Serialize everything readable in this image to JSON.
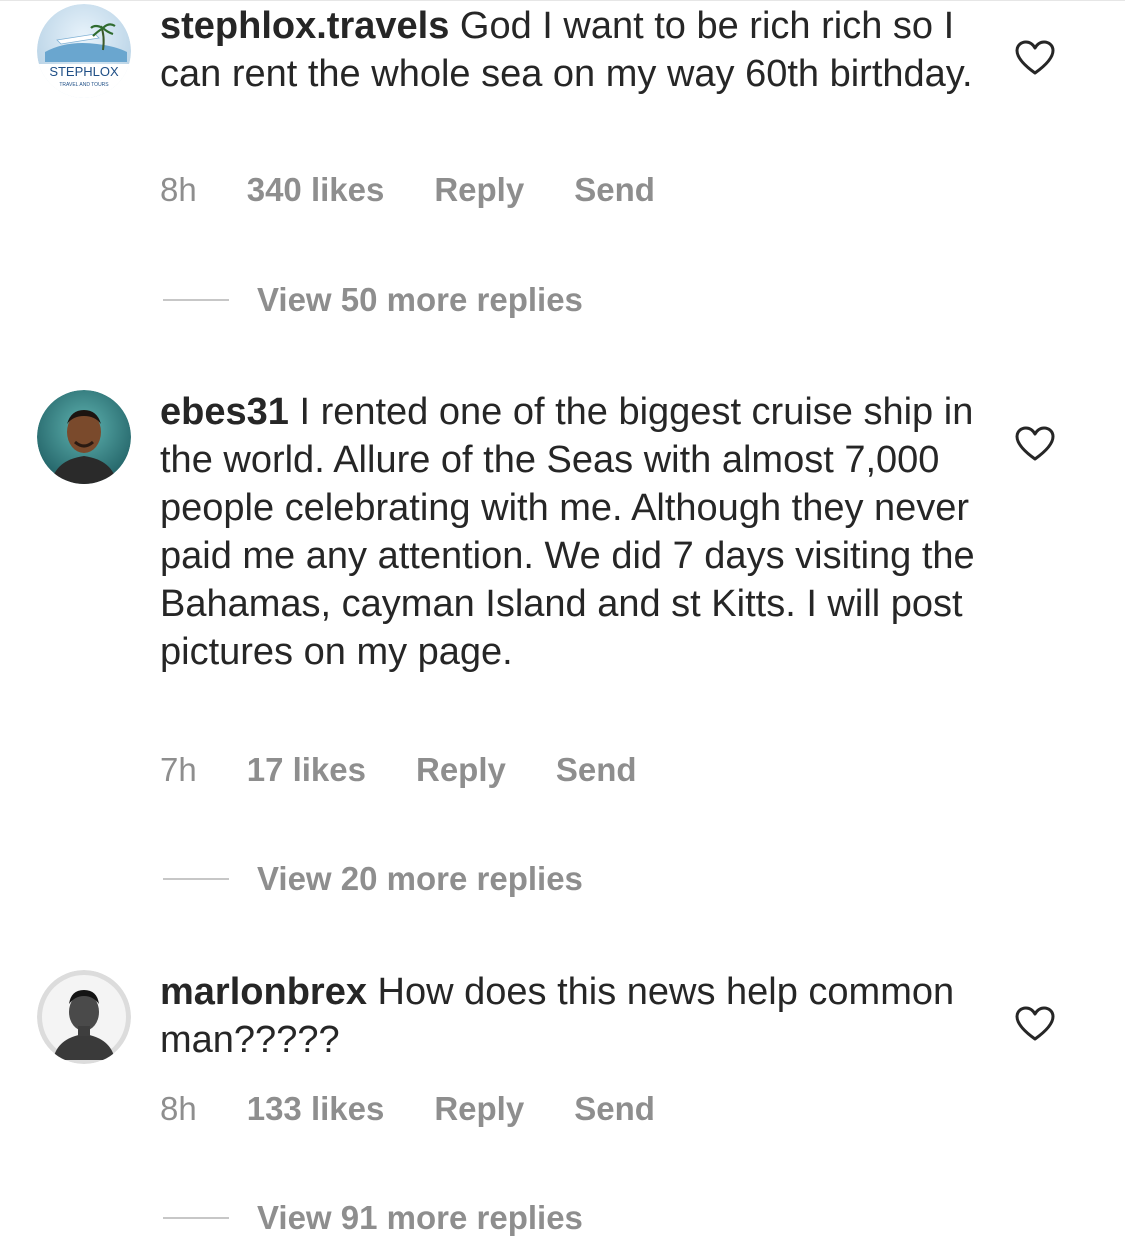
{
  "comments": [
    {
      "username": "stephlox.travels",
      "text": "God I want to be rich rich so I can rent the whole sea on my way 60th birthday.",
      "time": "8h",
      "likes": "340 likes",
      "reply_label": "Reply",
      "send_label": "Send",
      "view_replies": "View 50 more replies",
      "avatar_text": "STEPHLOX",
      "avatar_subtext": "TRAVEL AND TOURS"
    },
    {
      "username": "ebes31",
      "text": "I rented one of the biggest cruise ship in the world.  Allure of the Seas with almost 7,000 people celebrating with me. Although they never paid me any attention.  We did 7 days visiting the Bahamas, cayman Island and  st Kitts.  I will post pictures on my page.",
      "time": "7h",
      "likes": "17 likes",
      "reply_label": "Reply",
      "send_label": "Send",
      "view_replies": "View 20 more replies"
    },
    {
      "username": "marlonbrex",
      "text": "How does this news help common man?????",
      "time": "8h",
      "likes": "133 likes",
      "reply_label": "Reply",
      "send_label": "Send",
      "view_replies": "View 91 more replies"
    }
  ],
  "colors": {
    "text": "#262626",
    "secondary": "#8e8e8e",
    "divider": "#c7c7c7"
  }
}
